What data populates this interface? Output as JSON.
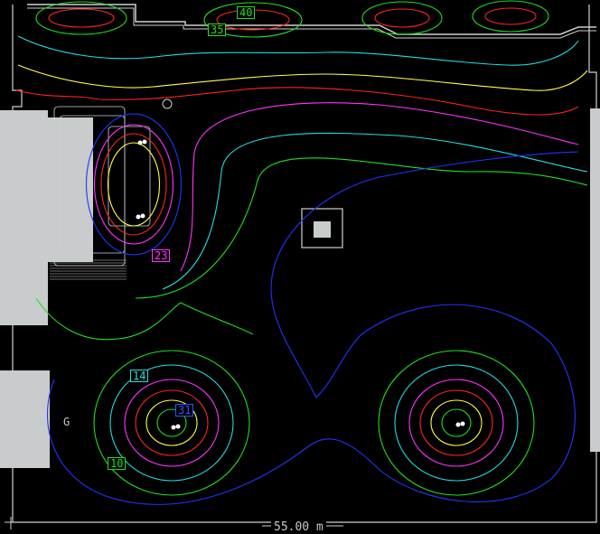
{
  "contour_labels": [
    {
      "id": "40",
      "text": "40",
      "color": "#22dd22"
    },
    {
      "id": "35",
      "text": "35",
      "color": "#22dd22"
    },
    {
      "id": "23",
      "text": "23",
      "color": "#ff33ff"
    },
    {
      "id": "14",
      "text": "14",
      "color": "#22dddd"
    },
    {
      "id": "31",
      "text": "31",
      "color": "#3355ff"
    },
    {
      "id": "10",
      "text": "10",
      "color": "#22dd22"
    }
  ],
  "scale_text": "55.00 m",
  "grid_marker": "G",
  "colors": {
    "background": "#000000",
    "wall": "#c8cccc",
    "outline": "#d0d0d0",
    "contour_blue": "#2233ff",
    "contour_cyan": "#22dddd",
    "contour_green": "#22dd22",
    "contour_yellow": "#ffff44",
    "contour_red": "#ff2222",
    "contour_magenta": "#ff33ff"
  }
}
